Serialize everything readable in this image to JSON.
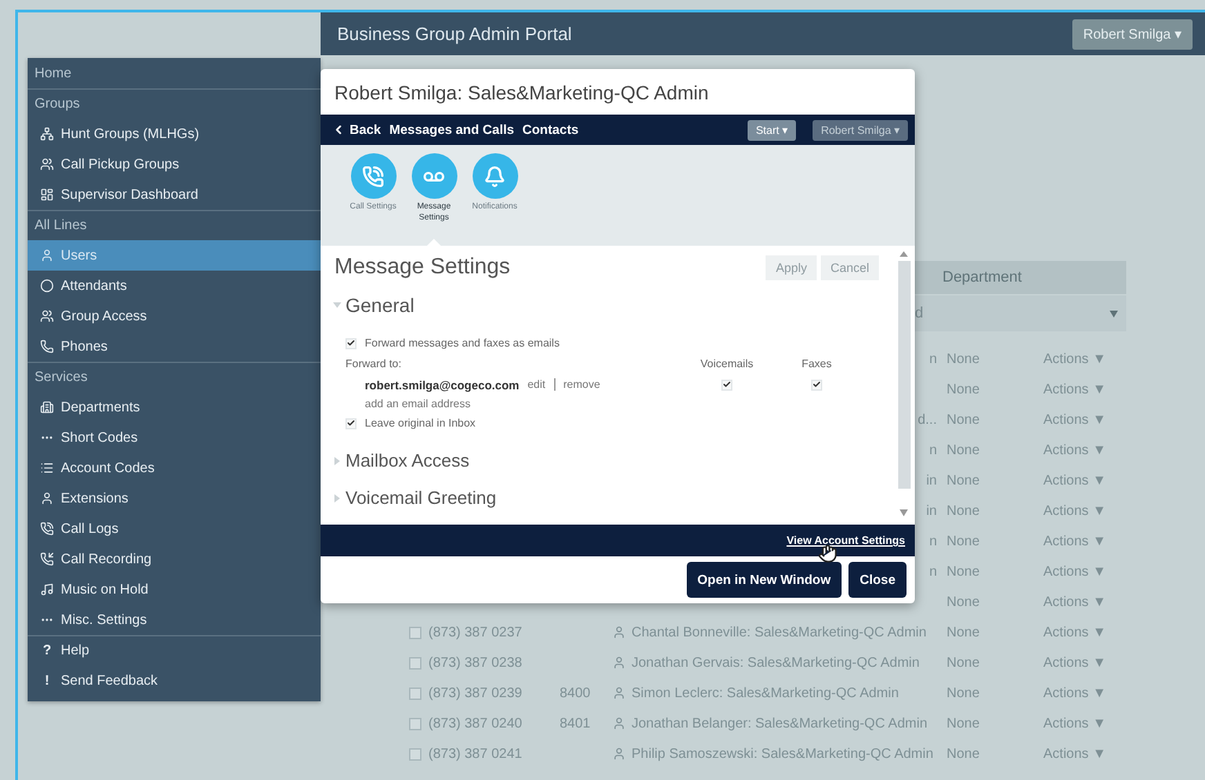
{
  "header": {
    "title": "Business Group Admin Portal",
    "user_menu": "Robert Smilga ▾"
  },
  "sidebar": {
    "items": [
      {
        "kind": "section",
        "label": "Home"
      },
      {
        "kind": "section",
        "label": "Groups"
      },
      {
        "kind": "link",
        "label": "Hunt Groups (MLHGs)",
        "selected": false
      },
      {
        "kind": "link",
        "label": "Call Pickup Groups",
        "selected": false
      },
      {
        "kind": "link",
        "label": "Supervisor Dashboard",
        "selected": false
      },
      {
        "kind": "section",
        "label": "All Lines"
      },
      {
        "kind": "link",
        "label": "Users",
        "selected": true
      },
      {
        "kind": "link",
        "label": "Attendants",
        "selected": false
      },
      {
        "kind": "link",
        "label": "Group Access",
        "selected": false
      },
      {
        "kind": "link",
        "label": "Phones",
        "selected": false
      },
      {
        "kind": "section",
        "label": "Services"
      },
      {
        "kind": "link",
        "label": "Departments",
        "selected": false
      },
      {
        "kind": "link",
        "label": "Short Codes",
        "selected": false
      },
      {
        "kind": "link",
        "label": "Account Codes",
        "selected": false
      },
      {
        "kind": "link",
        "label": "Extensions",
        "selected": false
      },
      {
        "kind": "link",
        "label": "Call Logs",
        "selected": false
      },
      {
        "kind": "link",
        "label": "Call Recording",
        "selected": false
      },
      {
        "kind": "link",
        "label": "Music on Hold",
        "selected": false
      },
      {
        "kind": "link",
        "label": "Misc. Settings",
        "selected": false
      },
      {
        "kind": "glyph",
        "glyph": "?",
        "label": "Help",
        "selected": false
      },
      {
        "kind": "glyph",
        "glyph": "!",
        "label": "Send Feedback",
        "selected": false
      }
    ]
  },
  "table": {
    "columns": [
      {
        "label": "Department"
      }
    ],
    "filter": "d",
    "rows": [
      {
        "name": "n",
        "department": "None",
        "actions": "Actions ▼"
      },
      {
        "department": "None",
        "actions": "Actions ▼"
      },
      {
        "name": "d...",
        "department": "None",
        "actions": "Actions ▼"
      },
      {
        "name": "n",
        "department": "None",
        "actions": "Actions ▼"
      },
      {
        "name": "in",
        "department": "None",
        "actions": "Actions ▼"
      },
      {
        "name": "in",
        "department": "None",
        "actions": "Actions ▼"
      },
      {
        "name": "n",
        "department": "None",
        "actions": "Actions ▼"
      },
      {
        "name": "n",
        "department": "None",
        "actions": "Actions ▼"
      },
      {
        "department": "None",
        "actions": "Actions ▼"
      },
      {
        "checked": false,
        "phone": "(873) 387 0237",
        "name": "Chantal Bonneville: Sales&Marketing-QC Admin",
        "department": "None",
        "actions": "Actions ▼"
      },
      {
        "checked": false,
        "phone": "(873) 387 0238",
        "name": "Jonathan Gervais: Sales&Marketing-QC Admin",
        "department": "None",
        "actions": "Actions ▼"
      },
      {
        "checked": false,
        "phone": "(873) 387 0239",
        "extension": "8400",
        "name": "Simon Leclerc: Sales&Marketing-QC Admin",
        "department": "None",
        "actions": "Actions ▼"
      },
      {
        "checked": false,
        "phone": "(873) 387 0240",
        "extension": "8401",
        "name": "Jonathan Belanger: Sales&Marketing-QC Admin",
        "department": "None",
        "actions": "Actions ▼"
      },
      {
        "checked": false,
        "phone": "(873) 387 0241",
        "name": "Philip Samoszewski: Sales&Marketing-QC Admin",
        "department": "None",
        "actions": "Actions ▼"
      }
    ]
  },
  "dialog": {
    "title": "Robert Smilga: Sales&Marketing-QC Admin",
    "nav": {
      "back": "Back",
      "links": [
        "Messages and Calls",
        "Contacts"
      ],
      "start": "Start ▾",
      "user": "Robert Smilga ▾"
    },
    "categories": [
      {
        "label": "Call Settings",
        "selected": false
      },
      {
        "label": "Message Settings",
        "selected": true
      },
      {
        "label": "Notifications",
        "selected": false
      }
    ],
    "heading": "Message Settings",
    "actions": [
      {
        "label": "Apply",
        "disabled": true
      },
      {
        "label": "Cancel",
        "disabled": true
      }
    ],
    "general": {
      "title": "General",
      "expanded": true,
      "forward_emails": {
        "label": "Forward messages and faxes as emails",
        "checked": true
      },
      "forward_to_label": "Forward to:",
      "columns": [
        "Voicemails",
        "Faxes"
      ],
      "addresses": [
        {
          "email": "robert.smilga@cogeco.com",
          "edit": "edit",
          "remove": "remove",
          "voicemails": true,
          "faxes": true
        }
      ],
      "add_address": "add an email address",
      "leave_original": {
        "label": "Leave original in Inbox",
        "checked": true
      }
    },
    "other_sections": [
      {
        "title": "Mailbox Access",
        "expanded": false
      },
      {
        "title": "Voicemail Greeting",
        "expanded": false
      }
    ],
    "footer_link": "View Account Settings",
    "buttons": [
      "Open in New Window",
      "Close"
    ]
  }
}
